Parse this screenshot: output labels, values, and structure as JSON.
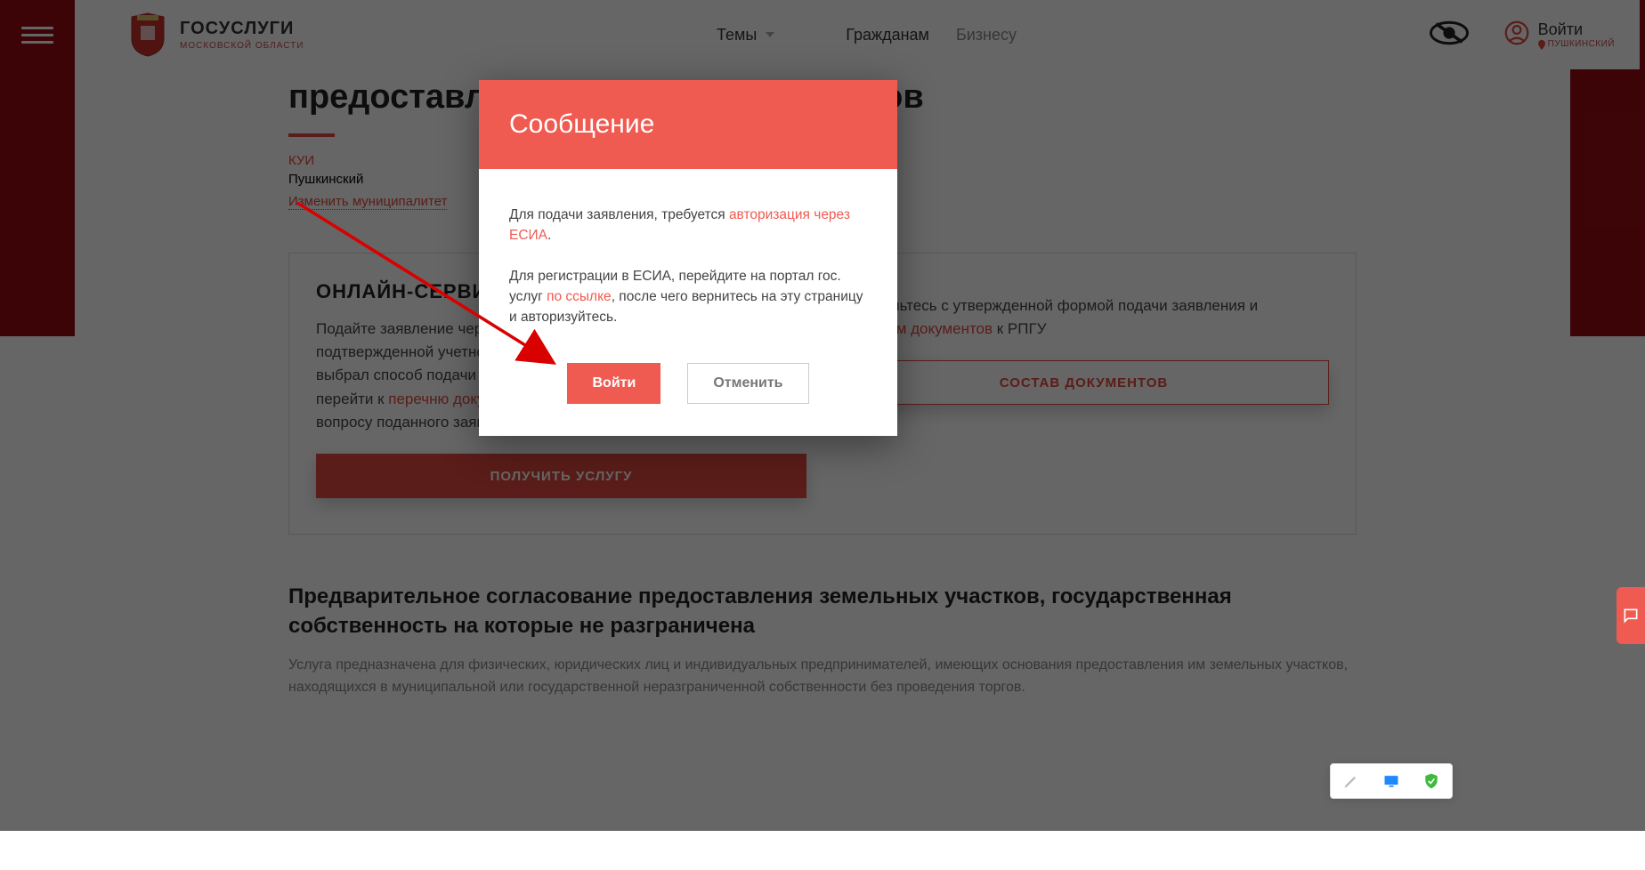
{
  "header": {
    "logo_title": "ГОСУСЛУГИ",
    "logo_sub": "МОСКОВСКОЙ ОБЛАСТИ",
    "nav": {
      "themes": "Темы",
      "citizens": "Гражданам",
      "business": "Бизнесу"
    },
    "login": {
      "label": "Войти",
      "geo": "ПУШКИНСКИЙ"
    }
  },
  "page": {
    "title_visible": "предоставления земельных участков",
    "meta_org": "КУИ",
    "meta_muni": "Пушкинский",
    "change_muni": "Изменить муниципалитет",
    "card1": {
      "title": "ОНЛАЙН-СЕРВИС",
      "body_prefix": "Подайте заявление через портал, авторизовавшись с помощью подтвержденной учетной записи ЕСИА. В случае, если заявитель выбрал способ подачи заявления в электронном виде, необходимо перейти к ",
      "body_link": "перечню документов",
      "body_suffix": " в МФЦ Московской области, по вопросу поданного заявления через РПГУ",
      "button": "ПОЛУЧИТЬ УСЛУГУ"
    },
    "card2": {
      "title": "",
      "body_prefix": "Ознакомьтесь с утвержденной формой подачи заявления и ",
      "body_link": "перечнем документов",
      "body_suffix": " к РПГУ",
      "button": "СОСТАВ ДОКУМЕНТОВ"
    },
    "sub_heading": "Предварительное согласование предоставления земельных участков, государственная собственность на которые не разграничена",
    "sub_para": "Услуга предназначена для физических, юридических лиц и индивидуальных предпринимателей, имеющих основания предоставления им земельных участков, находящихся в муниципальной или государственной неразграниченной собственности без проведения торгов."
  },
  "modal": {
    "title": "Сообщение",
    "p1_prefix": "Для подачи заявления, требуется ",
    "p1_link": "авторизация через ЕСИА",
    "p1_suffix": ".",
    "p2_prefix": "Для регистрации в ЕСИА, перейдите на портал гос. услуг ",
    "p2_link": "по ссылке",
    "p2_suffix": ", после чего вернитесь на эту страницу и авторизуйтесь.",
    "enter": "Войти",
    "cancel": "Отменить"
  }
}
